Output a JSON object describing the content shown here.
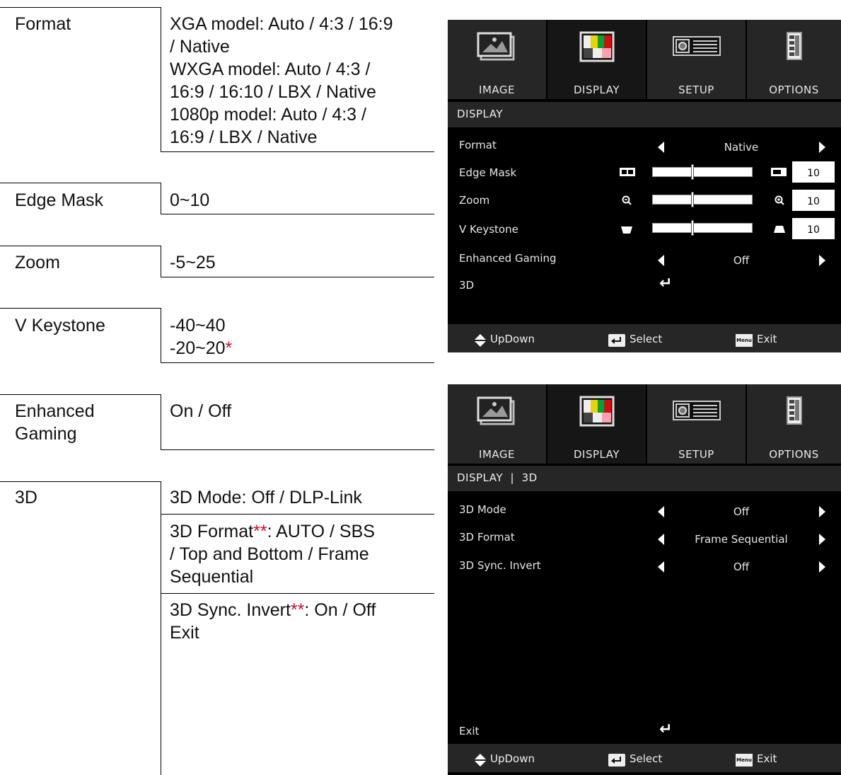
{
  "table": {
    "format": {
      "label": "Format",
      "values": [
        "XGA model: Auto / 4:3 / 16:9",
        "/ Native",
        "WXGA model: Auto / 4:3 /",
        "16:9 / 16:10 / LBX / Native",
        "1080p model: Auto / 4:3 /",
        "16:9 / LBX / Native"
      ]
    },
    "edge_mask": {
      "label": "Edge Mask",
      "value": "0~10"
    },
    "zoom": {
      "label": "Zoom",
      "value": "-5~25"
    },
    "v_keystone": {
      "label": "V Keystone",
      "value1": "-40~40",
      "value2": "-20~20",
      "mark": "*"
    },
    "enhanced_gaming": {
      "label_line1": "Enhanced",
      "label_line2": "Gaming",
      "value": "On / Off"
    },
    "three_d": {
      "label": "3D",
      "mode": "3D Mode: Off / DLP-Link",
      "format_prefix": "3D Format",
      "format_mark": "**",
      "format_line1_suffix": ": AUTO / SBS",
      "format_line2": "/ Top and Bottom / Frame",
      "format_line3": "Sequential",
      "sync_prefix": "3D Sync. Invert",
      "sync_mark": "**",
      "sync_suffix": ": On / Off",
      "exit": "Exit"
    }
  },
  "osd_common": {
    "tabs": [
      "IMAGE",
      "DISPLAY",
      "SETUP",
      "OPTIONS"
    ],
    "active_tab": "DISPLAY",
    "footer": {
      "updown": "UpDown",
      "select": "Select",
      "menu_key": "Menu",
      "exit": "Exit"
    },
    "colors": {
      "background": "#000000",
      "bar": "#262626",
      "text": "#e6e6e6"
    }
  },
  "osd_display": {
    "breadcrumb": "DISPLAY",
    "rows": {
      "format": {
        "label": "Format",
        "value": "Native"
      },
      "edge_mask": {
        "label": "Edge Mask",
        "value": "10",
        "level": 0.4
      },
      "zoom": {
        "label": "Zoom",
        "value": "10",
        "level": 0.4
      },
      "v_keystone": {
        "label": "V Keystone",
        "value": "10",
        "level": 0.4
      },
      "enhanced_gaming": {
        "label": "Enhanced Gaming",
        "value": "Off"
      },
      "three_d": {
        "label": "3D"
      }
    }
  },
  "osd_3d": {
    "breadcrumb": "DISPLAY  |  3D",
    "rows": {
      "mode": {
        "label": "3D Mode",
        "value": "Off"
      },
      "format": {
        "label": "3D Format",
        "value": "Frame Sequential"
      },
      "sync": {
        "label": "3D Sync. Invert",
        "value": "Off"
      },
      "exit": {
        "label": "Exit"
      }
    }
  }
}
